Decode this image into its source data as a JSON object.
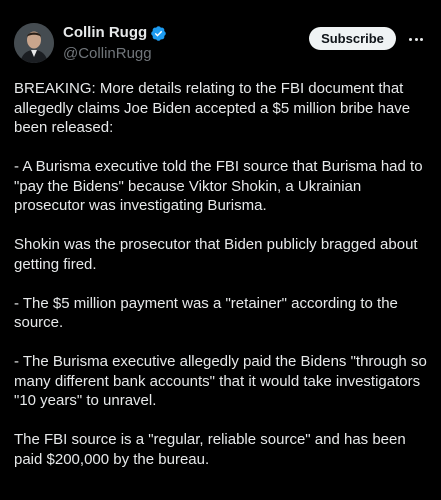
{
  "author": {
    "display_name": "Collin Rugg",
    "handle": "@CollinRugg",
    "verified": true,
    "verified_color": "#1d9bf0"
  },
  "actions": {
    "subscribe_label": "Subscribe",
    "more_icon": "more-horizontal-icon"
  },
  "tweet": {
    "paragraphs": [
      "BREAKING: More details relating to the FBI document that allegedly claims Joe Biden accepted a $5 million bribe have been released:",
      "- A Burisma executive told the FBI source that Burisma had to \"pay the Bidens\" because Viktor Shokin, a Ukrainian prosecutor was investigating Burisma.",
      "Shokin was the prosecutor that Biden publicly bragged about getting fired.",
      "- The $5 million payment was a \"retainer\" according to the source.",
      "- The Burisma executive allegedly paid the Bidens \"through so many different bank accounts\" that it would take investigators \"10 years\" to unravel.",
      "The FBI source is a \"regular, reliable source\" and has been paid $200,000 by the bureau."
    ]
  },
  "colors": {
    "background": "#000000",
    "text": "#e7e9ea",
    "secondary_text": "#71767b",
    "button_bg": "#eff3f4"
  }
}
